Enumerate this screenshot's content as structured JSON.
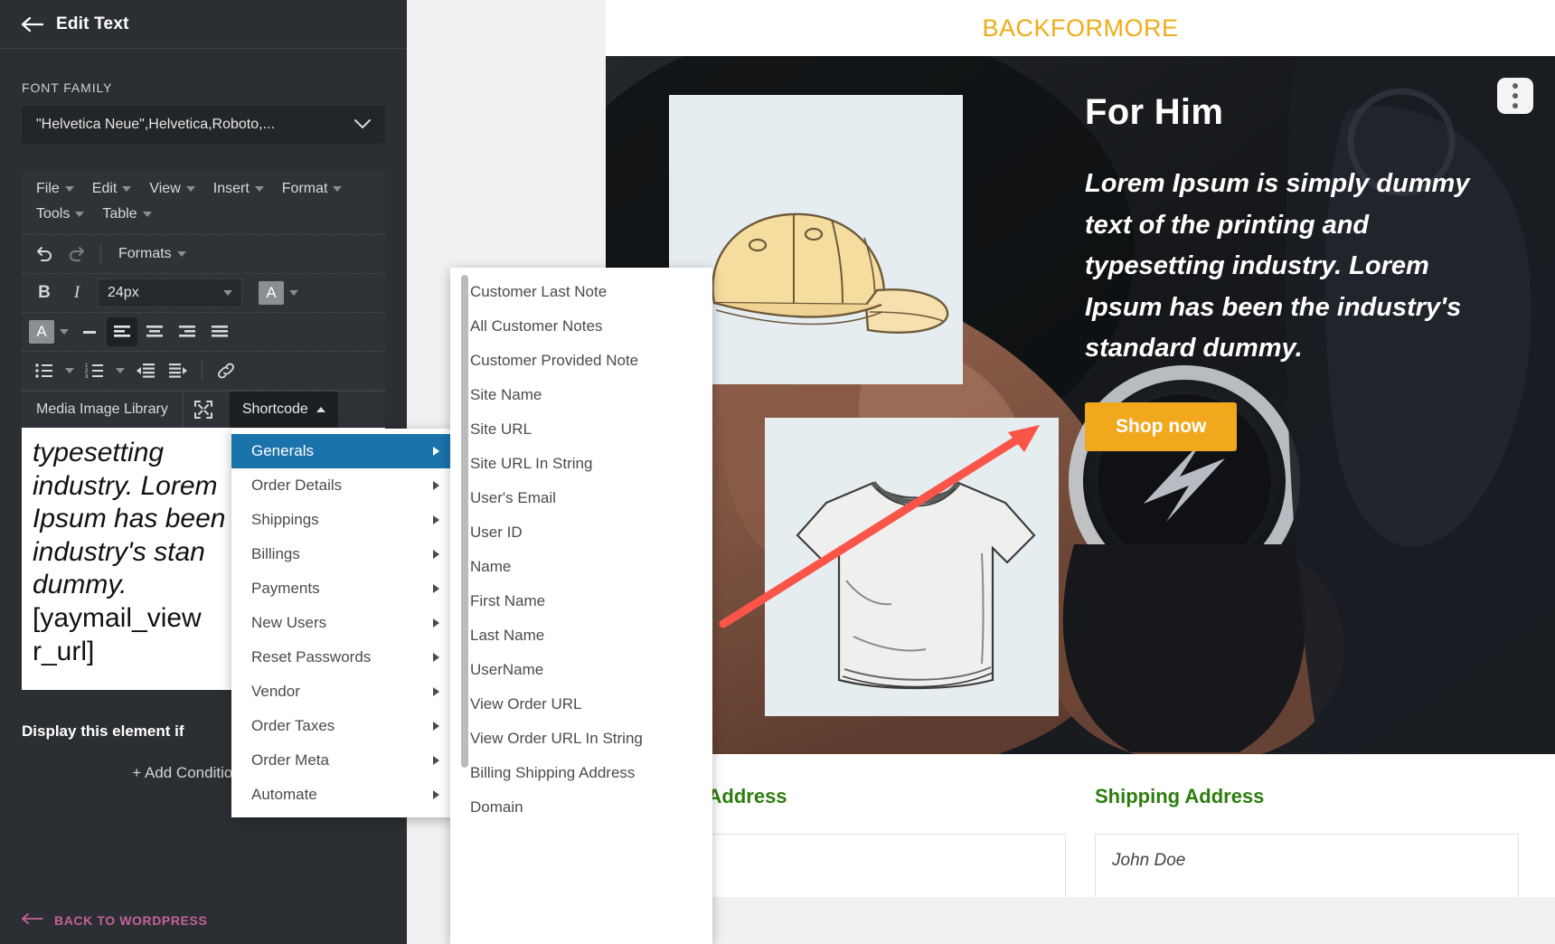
{
  "left_panel": {
    "back_icon": "back-arrow-icon",
    "title": "Edit Text",
    "font_family_label": "FONT FAMILY",
    "font_family_value": "\"Helvetica Neue\",Helvetica,Roboto,...",
    "menubar": [
      "File",
      "Edit",
      "View",
      "Insert",
      "Format",
      "Tools",
      "Table"
    ],
    "formats_label": "Formats",
    "font_size_value": "24px",
    "media_library_label": "Media Image Library",
    "shortcode_label": "Shortcode",
    "editor_text_line1": "typesetting",
    "editor_text_line2": "industry. Lorem",
    "editor_text_line3": "Ipsum has been",
    "editor_text_line4": "industry's stan",
    "editor_text_line5": "dummy.",
    "editor_shortcode_line1": "[yaymail_view",
    "editor_shortcode_line2": "r_url]",
    "display_condition_label": "Display this element if",
    "add_conditional_label": "+ Add Conditional",
    "back_to_wordpress_label": "BACK TO WORDPRESS",
    "accent_pink": "#c3619a"
  },
  "shortcode_menu": {
    "items": [
      {
        "label": "Generals",
        "selected": true
      },
      {
        "label": "Order Details",
        "selected": false
      },
      {
        "label": "Shippings",
        "selected": false
      },
      {
        "label": "Billings",
        "selected": false
      },
      {
        "label": "Payments",
        "selected": false
      },
      {
        "label": "New Users",
        "selected": false
      },
      {
        "label": "Reset Passwords",
        "selected": false
      },
      {
        "label": "Vendor",
        "selected": false
      },
      {
        "label": "Order Taxes",
        "selected": false
      },
      {
        "label": "Order Meta",
        "selected": false
      },
      {
        "label": "Automate",
        "selected": false
      }
    ],
    "highlight_color": "#1b73ac"
  },
  "generals_submenu": {
    "items": [
      "Customer Last Note",
      "All Customer Notes",
      "Customer Provided Note",
      "Site Name",
      "Site URL",
      "Site URL In String",
      "User's Email",
      "User ID",
      "Name",
      "First Name",
      "Last Name",
      "UserName",
      "View Order URL",
      "View Order URL In String",
      "Billing Shipping Address",
      "Domain"
    ]
  },
  "preview": {
    "promo_text": "BACKFORMORE",
    "promo_color": "#eeac18",
    "options_icon": "three-dots-vertical-icon",
    "hero_title": "For Him",
    "hero_copy": "Lorem Ipsum is simply dummy text of the printing and typesetting industry. Lorem Ipsum has been the industry's standard dummy.",
    "shop_button_label": "Shop now",
    "shop_button_color": "#f2a81d",
    "product_cap": "baseball-cap-illustration",
    "product_shirt": "t-shirt-illustration",
    "billing_address_heading": "Billing Address",
    "shipping_address_heading": "Shipping Address",
    "address_heading_color": "#2e7d0f",
    "billing_address_value": "",
    "shipping_address_value": "John Doe"
  },
  "annotation": {
    "arrow_color": "#fa5548",
    "name": "red-pointer-arrow"
  }
}
